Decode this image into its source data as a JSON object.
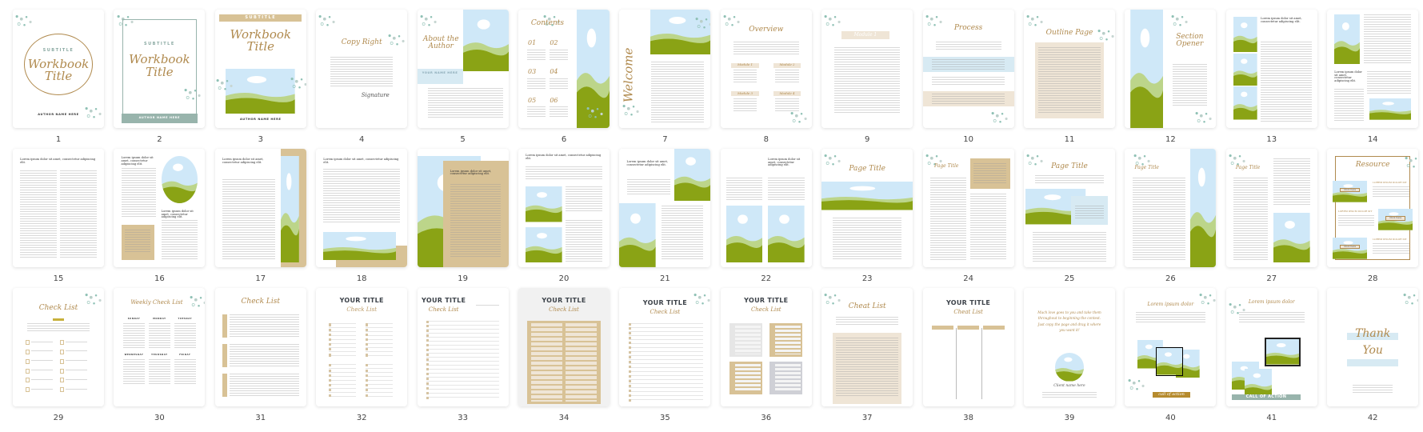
{
  "colors": {
    "tan": "#d8c296",
    "gold": "#b08a4e",
    "teal": "#8fc1b5",
    "sage": "#98b4ac",
    "sky": "#cfe8f8",
    "green": "#8aa315",
    "light_green": "#bcd58a",
    "cta_gold": "#b68b2e",
    "beige": "#efe5d6",
    "blue_box": "#d7eaf3"
  },
  "pages": [
    {
      "number": "1",
      "subtitle": "SUBTITLE",
      "title": "Workbook Title",
      "author": "AUTHOR NAME HERE"
    },
    {
      "number": "2",
      "subtitle": "SUBTITLE",
      "title": "Workbook Title",
      "author": "AUTHOR NAME HERE"
    },
    {
      "number": "3",
      "subtitle": "SUBTITLE",
      "title": "Workbook Title",
      "author": "AUTHOR NAME HERE"
    },
    {
      "number": "4",
      "title": "Copy Right",
      "signature": "Signature"
    },
    {
      "number": "5",
      "title": "About the Author",
      "name": "YOUR NAME HERE"
    },
    {
      "number": "6",
      "title": "Contents",
      "items": [
        "01",
        "02",
        "03",
        "04",
        "05",
        "06"
      ]
    },
    {
      "number": "7",
      "title": "Welcome"
    },
    {
      "number": "8",
      "title": "Overview",
      "modules": [
        "Module 1",
        "Module 2",
        "Module 3",
        "Module 4"
      ]
    },
    {
      "number": "9",
      "module": "Module 1"
    },
    {
      "number": "10",
      "title": "Process"
    },
    {
      "number": "11",
      "title": "Outline Page"
    },
    {
      "number": "12",
      "title": "Section Opener"
    },
    {
      "number": "13",
      "heading": "Lorem ipsum dolor sit amet, consectetur adipiscing elit."
    },
    {
      "number": "14",
      "heading": "Lorem ipsum dolor sit amet, consectetur adipiscing elit."
    },
    {
      "number": "15",
      "heading": "Lorem ipsum dolor sit amet, consectetur adipiscing elit."
    },
    {
      "number": "16",
      "heading": "Lorem ipsum dolor sit amet, consectetur adipiscing elit."
    },
    {
      "number": "17",
      "heading": "Lorem ipsum dolor sit amet, consectetur adipiscing elit."
    },
    {
      "number": "18",
      "heading": "Lorem ipsum dolor sit amet, consectetur adipiscing elit."
    },
    {
      "number": "19",
      "heading": "Lorem ipsum dolor sit amet, consectetur adipiscing elit."
    },
    {
      "number": "20",
      "heading": "Lorem ipsum dolor sit amet, consectetur adipiscing elit."
    },
    {
      "number": "21",
      "heading": "Lorem ipsum dolor sit amet, consectetur adipiscing elit."
    },
    {
      "number": "22",
      "headings": [
        "Lorem ipsum dolor sit amet, consectetur adipiscing elit.",
        "Lorem ipsum dolor sit amet, consectetur adipiscing elit."
      ]
    },
    {
      "number": "23",
      "title": "Page Title"
    },
    {
      "number": "24",
      "title": "Page Title"
    },
    {
      "number": "25",
      "title": "Page Title"
    },
    {
      "number": "26",
      "title": "Page Title"
    },
    {
      "number": "27",
      "title": "Page Title"
    },
    {
      "number": "28",
      "title": "Resource",
      "items": [
        {
          "label": "LOREM IPSUM DOLOR SIT",
          "button": "Click here"
        },
        {
          "label": "LOREM IPSUM DOLOR SIT",
          "button": "Click here"
        },
        {
          "label": "LOREM IPSUM DOLOR SIT",
          "button": "Click here"
        }
      ]
    },
    {
      "number": "29",
      "title": "Check List"
    },
    {
      "number": "30",
      "title": "Weekly Check List",
      "days": [
        "SUNDAY",
        "MONDAY",
        "TUESDAY",
        "WEDNESDAY",
        "THURSDAY",
        "FRIDAY"
      ]
    },
    {
      "number": "31",
      "title": "Check List"
    },
    {
      "number": "32",
      "title": "YOUR TITLE",
      "subtitle": "Check List"
    },
    {
      "number": "33",
      "title": "YOUR TITLE",
      "subtitle": "Check List"
    },
    {
      "number": "34",
      "title": "YOUR TITLE",
      "subtitle": "Check List"
    },
    {
      "number": "35",
      "title": "YOUR TITLE",
      "subtitle": "Check List"
    },
    {
      "number": "36",
      "title": "YOUR TITLE",
      "subtitle": "Check List"
    },
    {
      "number": "37",
      "title": "Cheat List"
    },
    {
      "number": "38",
      "title": "YOUR TITLE",
      "subtitle": "Cheat List"
    },
    {
      "number": "39",
      "quote": "Much love goes to you and take them throughout to beginning the contest. Just copy the page and drag it where you want it!",
      "client": "Client name here"
    },
    {
      "number": "40",
      "title": "Lorem ipsum dolor",
      "cta": "call of action"
    },
    {
      "number": "41",
      "title": "Lorem ipsum dolor",
      "cta": "CALL OF ACTION"
    },
    {
      "number": "42",
      "title": "Thank You"
    }
  ]
}
